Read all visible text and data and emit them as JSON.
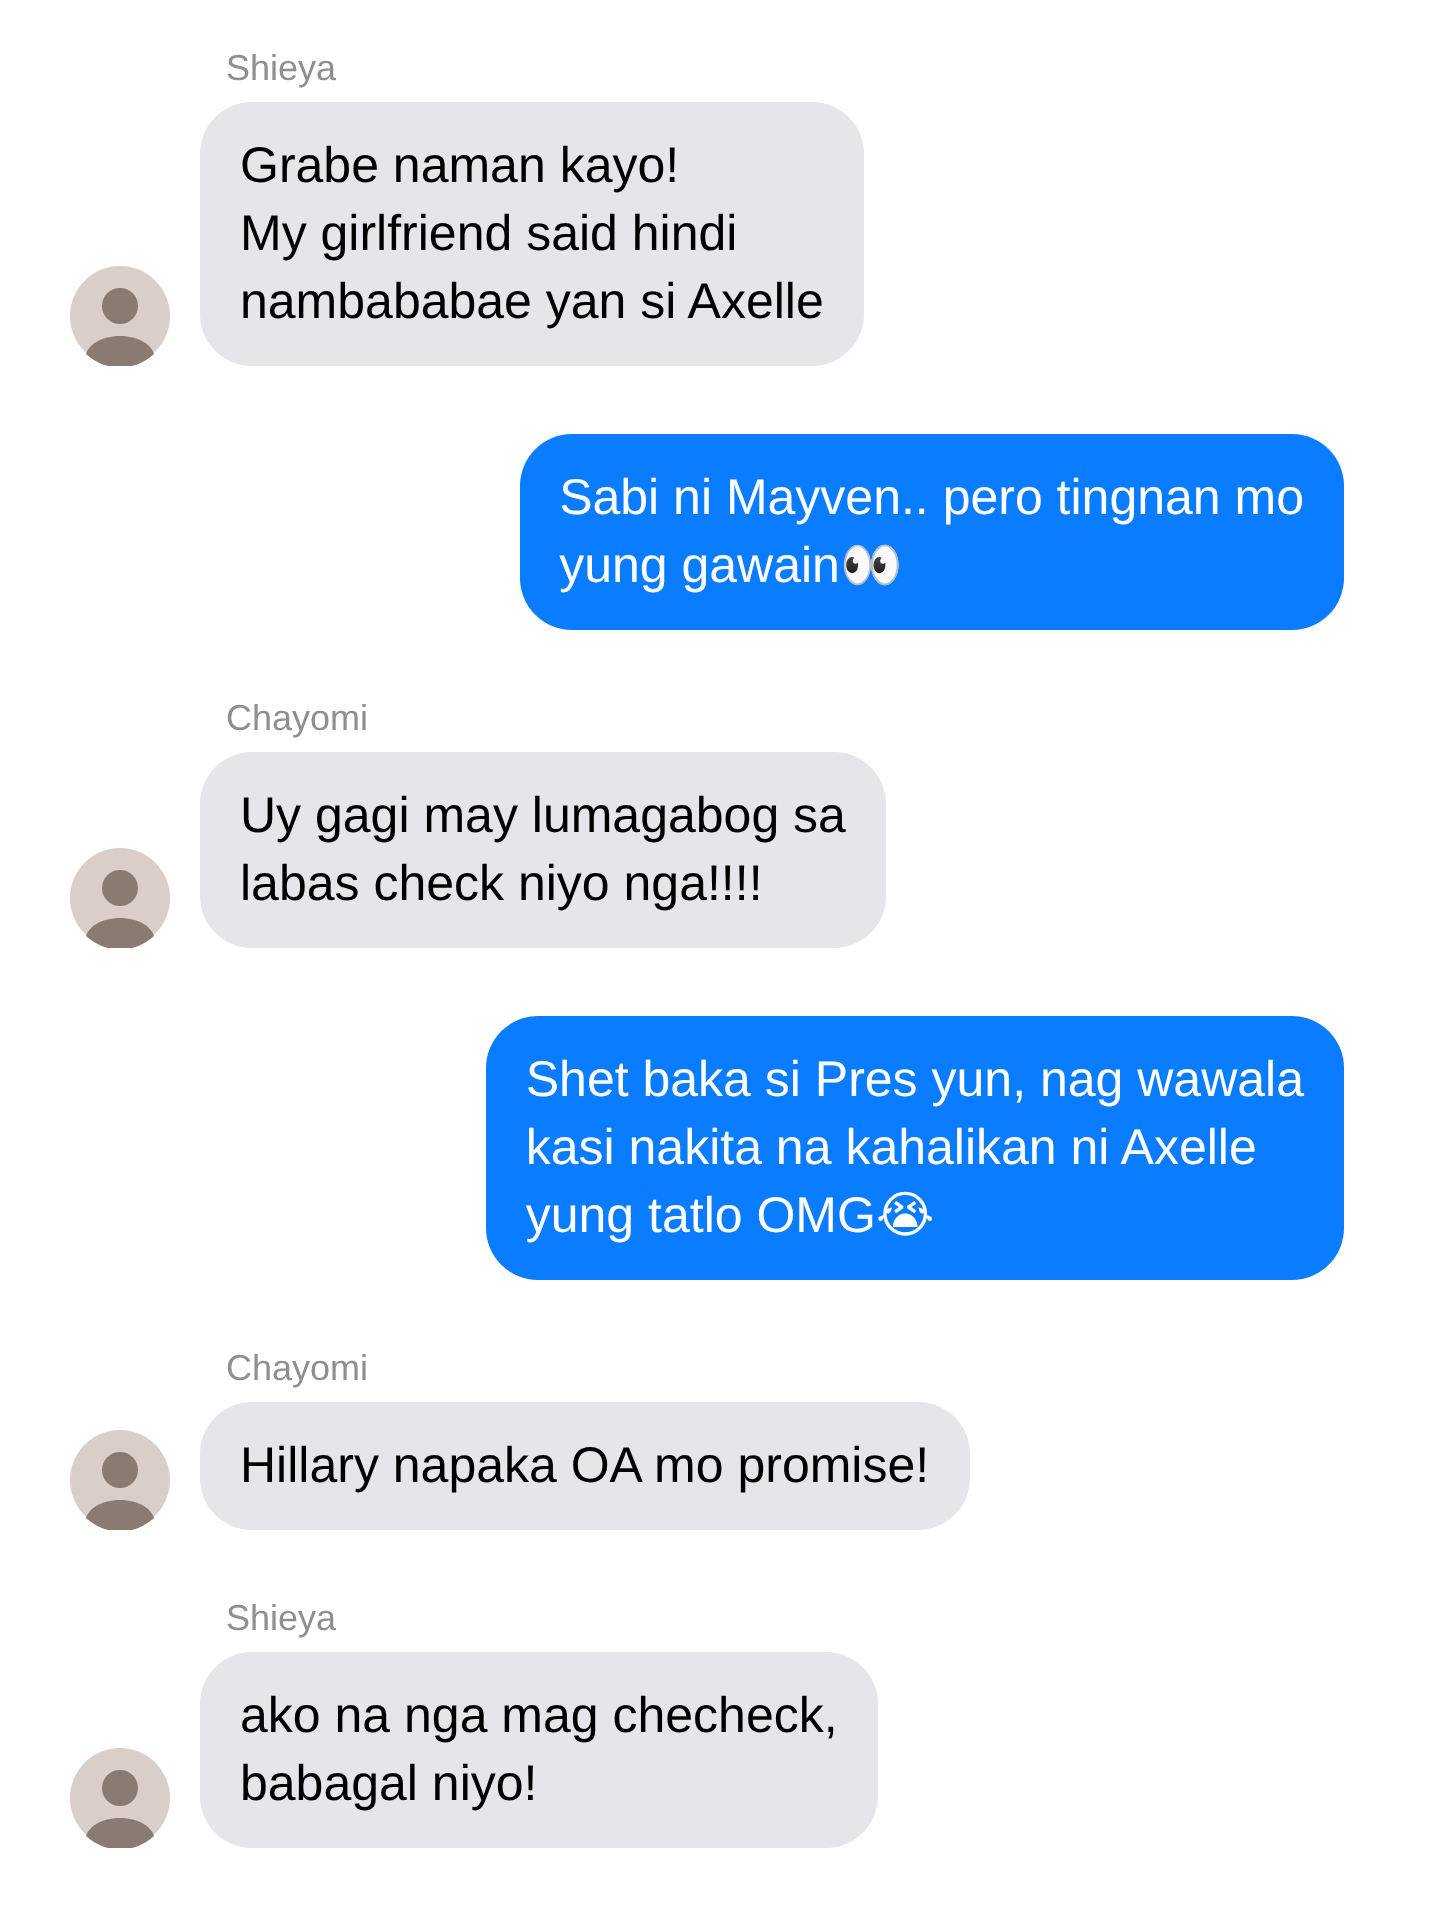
{
  "messages": [
    {
      "kind": "incoming",
      "sender": "Shieya",
      "lines": [
        "Grabe naman kayo!",
        "My girlfriend said hindi",
        "nambababae yan si Axelle"
      ]
    },
    {
      "kind": "outgoing",
      "lines": [
        "Sabi ni Mayven.. pero tingnan mo",
        "yung gawain👀"
      ]
    },
    {
      "kind": "incoming",
      "sender": "Chayomi",
      "lines": [
        "Uy gagi may lumagabog sa",
        "labas check niyo nga!!!!"
      ]
    },
    {
      "kind": "outgoing",
      "lines": [
        "Shet baka si Pres yun, nag wawala",
        "kasi nakita na kahalikan ni Axelle",
        "yung tatlo OMG😭"
      ]
    },
    {
      "kind": "incoming",
      "sender": "Chayomi",
      "lines": [
        "Hillary napaka OA mo promise!"
      ]
    },
    {
      "kind": "incoming",
      "sender": "Shieya",
      "lines": [
        "ako na nga mag checheck,",
        "babagal niyo!"
      ]
    }
  ]
}
